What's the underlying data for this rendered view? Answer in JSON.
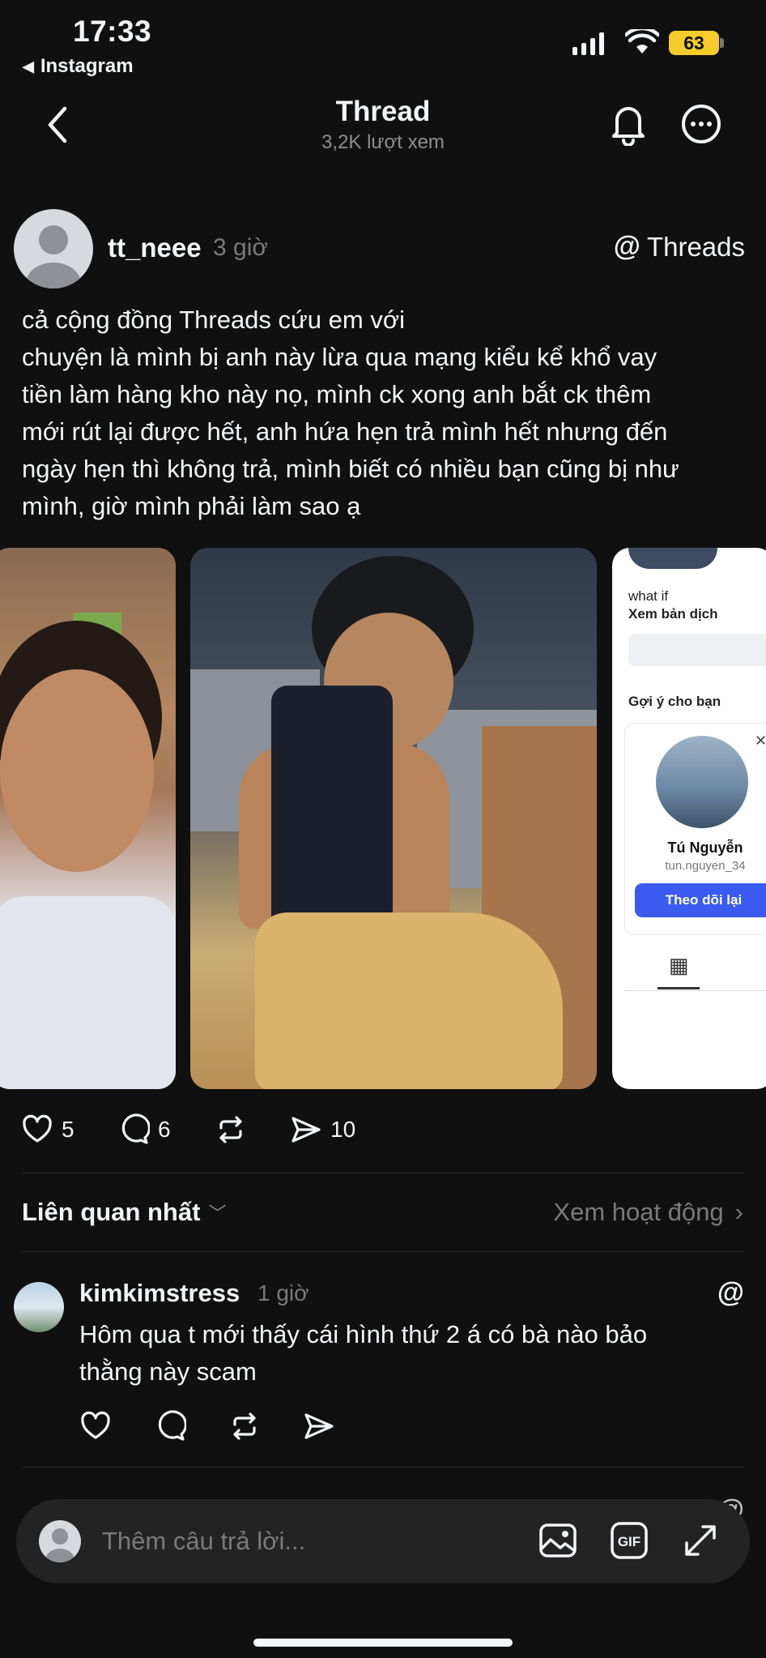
{
  "status_bar": {
    "time": "17:33",
    "back_app": "Instagram",
    "battery": "63"
  },
  "header": {
    "title": "Thread",
    "views": "3,2K lượt xem"
  },
  "post": {
    "author": "tt_neee",
    "time": "3 giờ",
    "source": "Threads",
    "lines": [
      "cả cộng đồng Threads cứu em với",
      "chuyện là mình bị anh này lừa qua mạng kiểu kể khổ vay",
      "tiền làm hàng kho này nọ, mình ck xong anh bắt ck thêm",
      "mới rút lại được hết, anh hứa hẹn trả mình hết nhưng đến",
      "ngày hẹn thì không trả, mình biết có nhiều bạn cũng bị như",
      "mình, giờ mình phải làm sao ạ"
    ],
    "screenshot": {
      "text1": "what if",
      "text2": "Xem bản dịch",
      "suggest": "Gợi ý cho bạn",
      "name": "Tú Nguyễn",
      "handle": "tun.nguyen_34",
      "button": "Theo dõi lại"
    },
    "likes": "5",
    "comments": "6",
    "shares": "10"
  },
  "replies": {
    "sort_label": "Liên quan nhất",
    "activity_label": "Xem hoạt động"
  },
  "comment": {
    "user": "kimkimstress",
    "time": "1 giờ",
    "lines": [
      "Hôm qua t mới thấy cái hình thứ 2 á có bà nào bảo",
      "thằng này scam"
    ]
  },
  "reply_bar": {
    "placeholder": "Thêm câu trả lời..."
  },
  "colors": {
    "background": "#101010",
    "text": "#f3f5f7",
    "muted": "#7a7a7a",
    "battery": "#f5cc2a",
    "follow_button": "#3b5bf0"
  },
  "icons": [
    "back-arrow-icon",
    "bell-icon",
    "more-icon",
    "threads-logo-icon",
    "heart-icon",
    "comment-icon",
    "repost-icon",
    "share-icon",
    "image-icon",
    "gif-icon",
    "expand-icon"
  ]
}
